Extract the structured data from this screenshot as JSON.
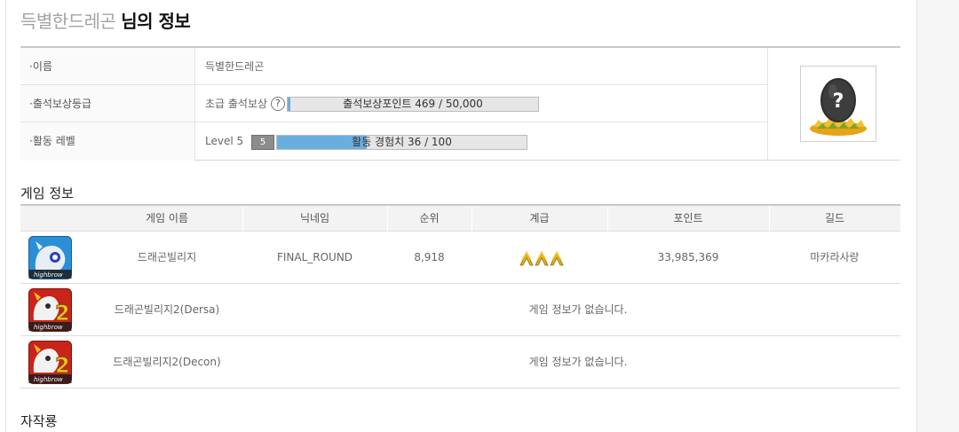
{
  "header": {
    "nickname": "득별한드레곤",
    "suffix": "님의 정보"
  },
  "profile": {
    "rows": [
      {
        "label": "·이름",
        "value": "득별한드레곤"
      },
      {
        "label": "·출석보상등급",
        "grade": "초급 출석보상",
        "help_icon": "?",
        "bar_text": "출석보상포인트 469 / 50,000",
        "progress": 0.0094
      },
      {
        "label": "·활동 레벨",
        "level_text": "Level 5",
        "level_badge": "5",
        "bar_text": "활동 경험치 36 / 100",
        "progress": 0.36
      }
    ],
    "avatar_icon": "mystery-egg-icon",
    "avatar_glyph": "?"
  },
  "games_section": {
    "title": "게임 정보",
    "columns": [
      "게임 이름",
      "닉네임",
      "순위",
      "계급",
      "포인트",
      "길드"
    ],
    "rows": [
      {
        "icon": "dragon-village-icon",
        "game": "드래곤빌리지",
        "nickname": "FINAL_ROUND",
        "rank": "8,918",
        "grade_icon": "chevron-rank-icon",
        "points": "33,985,369",
        "guild": "마카라사랑"
      },
      {
        "icon": "dragon-village-2-icon",
        "game": "드래곤빌리지2(Dersa)",
        "message": "게임 정보가 없습니다."
      },
      {
        "icon": "dragon-village-2-icon",
        "game": "드래곤빌리지2(Decon)",
        "message": "게임 정보가 없습니다."
      }
    ]
  },
  "next_section": {
    "title": "자작룡"
  },
  "colors": {
    "progress_fill": "#6aaee0",
    "header_bg": "#f3f3f3",
    "rank_gold": "#e0b21a"
  }
}
